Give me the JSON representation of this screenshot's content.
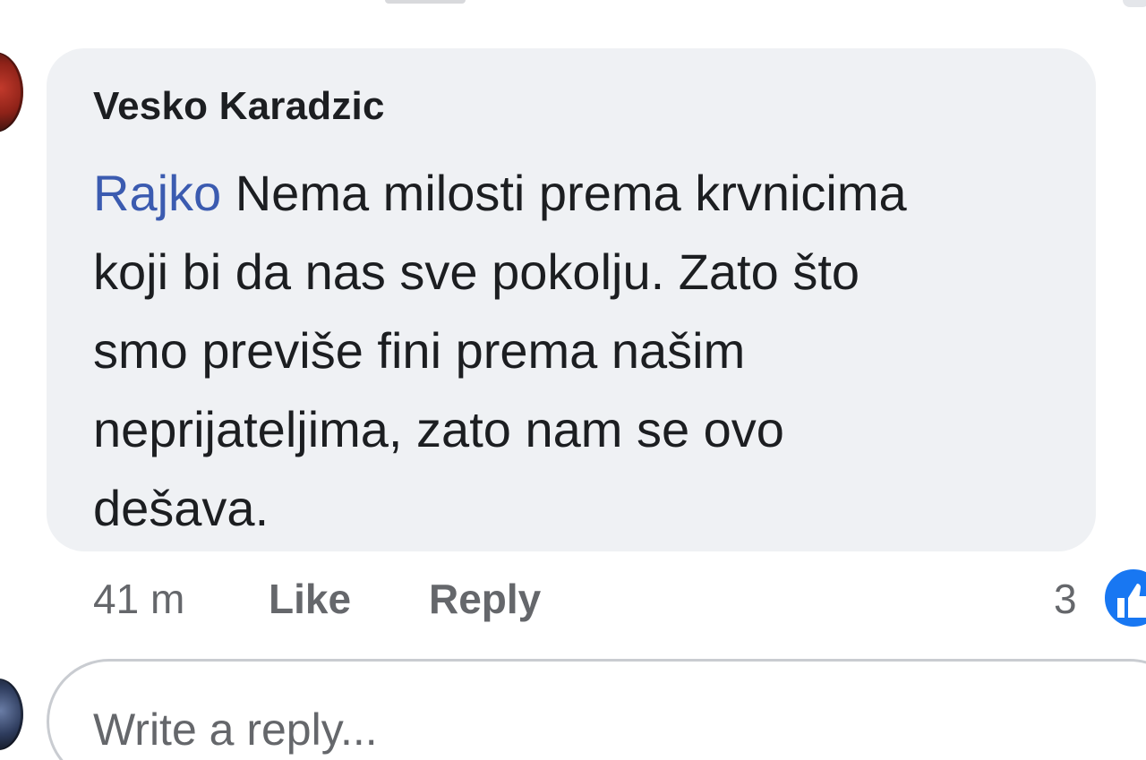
{
  "comment": {
    "author": "Vesko Karadzic",
    "mention": "Rajko",
    "text_lines": [
      " Nema milosti prema krvnicima",
      "koji bi da nas sve pokolju. Zato što",
      "smo previše fini prema našim",
      "neprijateljima, zato nam se ovo",
      "dešava."
    ],
    "timestamp": "41 m",
    "like_label": "Like",
    "reply_label": "Reply",
    "reaction_count": "3",
    "reaction_icon": "thumbs-up-icon"
  },
  "reply_box": {
    "placeholder": "Write a reply..."
  },
  "colors": {
    "bubble_bg": "#eff1f4",
    "mention": "#3b5bb0",
    "meta_text": "#65676b",
    "like_blue": "#1877f2"
  }
}
